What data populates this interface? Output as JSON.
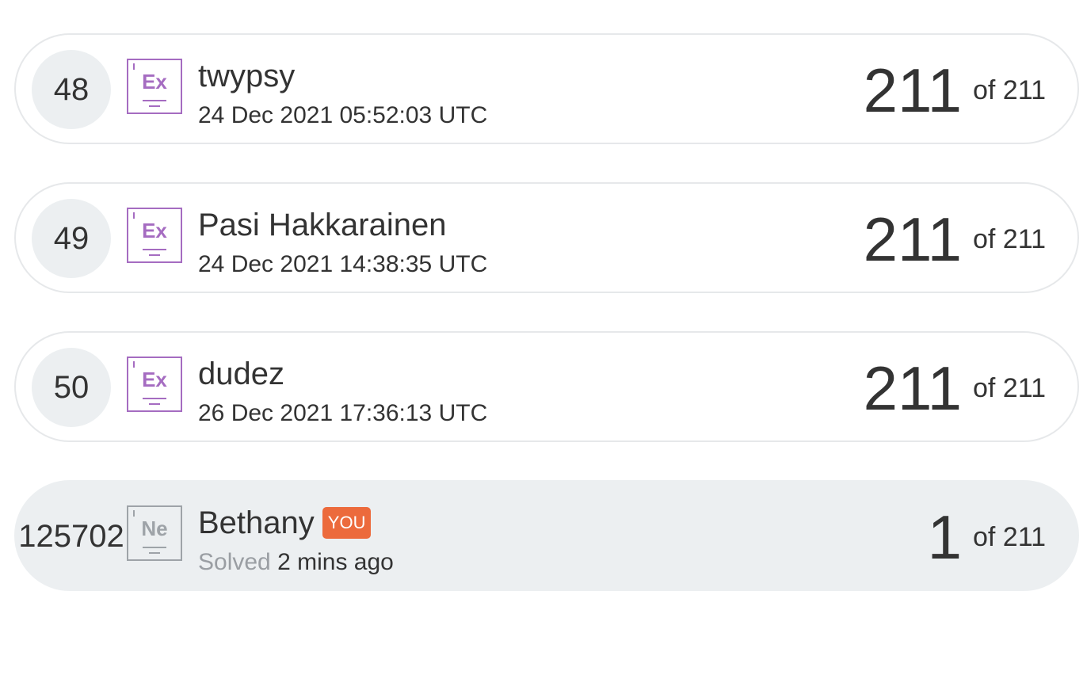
{
  "leaderboard": {
    "rows": [
      {
        "rank": "48",
        "badge": "Ex",
        "name": "twypsy",
        "timestamp": "24 Dec 2021 05:52:03 UTC",
        "score": "211",
        "total": "of 211"
      },
      {
        "rank": "49",
        "badge": "Ex",
        "name": "Pasi Hakkarainen",
        "timestamp": "24 Dec 2021 14:38:35 UTC",
        "score": "211",
        "total": "of 211"
      },
      {
        "rank": "50",
        "badge": "Ex",
        "name": "dudez",
        "timestamp": "26 Dec 2021 17:36:13 UTC",
        "score": "211",
        "total": "of 211"
      }
    ],
    "current_user": {
      "rank": "125702",
      "badge": "Ne",
      "name": "Bethany",
      "you_label": "YOU",
      "solved_label": "Solved",
      "solved_time": "2 mins ago",
      "score": "1",
      "total": "of 211"
    }
  },
  "colors": {
    "badge_expert": "#a56cc1",
    "badge_newbie": "#9ea3a8",
    "you_badge": "#ec6a3c",
    "highlight_row": "#eceff1"
  }
}
